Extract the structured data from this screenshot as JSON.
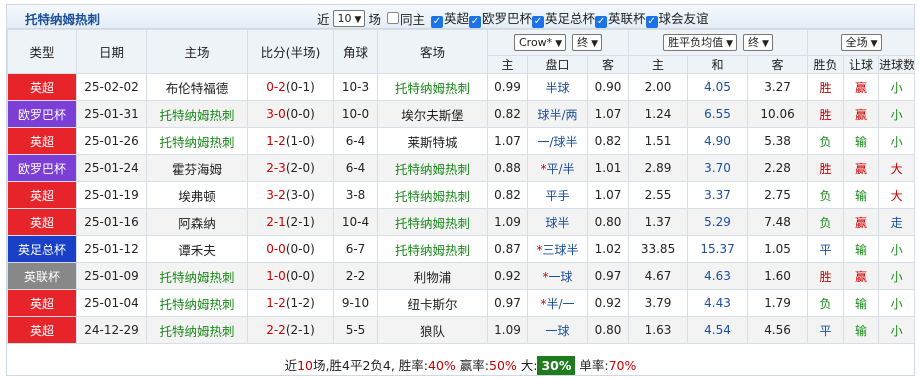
{
  "team_title": "托特纳姆热刺",
  "filter": {
    "prefix": "近",
    "count": "10",
    "suffix": "场",
    "same_home": "同主",
    "checks": [
      {
        "label": "英超",
        "on": true
      },
      {
        "label": "欧罗巴杯",
        "on": true
      },
      {
        "label": "英足总杯",
        "on": true
      },
      {
        "label": "英联杯",
        "on": true
      },
      {
        "label": "球会友谊",
        "on": true
      }
    ]
  },
  "headers": {
    "type": "类型",
    "date": "日期",
    "home": "主场",
    "score": "比分(半场)",
    "corner": "角球",
    "away": "客场",
    "company": "Crow*",
    "period1": "终",
    "period2": "终",
    "odds_type": "胜平负均值",
    "result_filter": "全场",
    "wl": "胜负",
    "hc": "让球",
    "ou": "进球数"
  },
  "sub": {
    "h": "主",
    "line": "盘口",
    "a": "客",
    "w": "主",
    "d": "和",
    "l": "客"
  },
  "rows": [
    {
      "league": "英超",
      "lc": "#e8242b",
      "date": "25-02-02",
      "home": "布伦特福德",
      "score": "0-2",
      "half": "(0-1)",
      "corner": "10-3",
      "away": "托特纳姆热刺",
      "ho": "0.99",
      "line": "半球",
      "ast": "",
      "ao": "0.90",
      "w": "2.00",
      "d": "4.05",
      "l": "3.27",
      "wl": "胜",
      "hc": "赢",
      "ou": "小"
    },
    {
      "league": "欧罗巴杯",
      "lc": "#7b3fd6",
      "date": "25-01-31",
      "home": "托特纳姆热刺",
      "score": "3-0",
      "half": "(0-0)",
      "corner": "10-0",
      "away": "埃尔夫斯堡",
      "ho": "0.82",
      "line": "球半/两",
      "ast": "",
      "ao": "1.07",
      "w": "1.24",
      "d": "6.55",
      "l": "10.06",
      "wl": "胜",
      "hc": "赢",
      "ou": "小"
    },
    {
      "league": "英超",
      "lc": "#e8242b",
      "date": "25-01-26",
      "home": "托特纳姆热刺",
      "score": "1-2",
      "half": "(1-0)",
      "corner": "6-4",
      "away": "莱斯特城",
      "ho": "1.07",
      "line": "一/球半",
      "ast": "",
      "ao": "0.82",
      "w": "1.51",
      "d": "4.90",
      "l": "5.38",
      "wl": "负",
      "hc": "输",
      "ou": "小"
    },
    {
      "league": "欧罗巴杯",
      "lc": "#7b3fd6",
      "date": "25-01-24",
      "home": "霍芬海姆",
      "score": "2-3",
      "half": "(2-0)",
      "corner": "6-4",
      "away": "托特纳姆热刺",
      "ho": "0.88",
      "line": "平/半",
      "ast": "*",
      "ao": "1.01",
      "w": "2.89",
      "d": "3.70",
      "l": "2.28",
      "wl": "胜",
      "hc": "赢",
      "ou": "大"
    },
    {
      "league": "英超",
      "lc": "#e8242b",
      "date": "25-01-19",
      "home": "埃弗顿",
      "score": "3-2",
      "half": "(3-0)",
      "corner": "3-8",
      "away": "托特纳姆热刺",
      "ho": "0.82",
      "line": "平手",
      "ast": "",
      "ao": "1.07",
      "w": "2.55",
      "d": "3.37",
      "l": "2.75",
      "wl": "负",
      "hc": "输",
      "ou": "大"
    },
    {
      "league": "英超",
      "lc": "#e8242b",
      "date": "25-01-16",
      "home": "阿森纳",
      "score": "2-1",
      "half": "(2-1)",
      "corner": "10-4",
      "away": "托特纳姆热刺",
      "ho": "1.09",
      "line": "球半",
      "ast": "",
      "ao": "0.80",
      "w": "1.37",
      "d": "5.29",
      "l": "7.48",
      "wl": "负",
      "hc": "赢",
      "ou": "走"
    },
    {
      "league": "英足总杯",
      "lc": "#1a40c8",
      "date": "25-01-12",
      "home": "谭禾夫",
      "score": "0-0",
      "half": "(0-0)",
      "corner": "6-7",
      "away": "托特纳姆热刺",
      "ho": "0.87",
      "line": "三球半",
      "ast": "*",
      "ao": "1.02",
      "w": "33.85",
      "d": "15.37",
      "l": "1.05",
      "wl": "平",
      "hc": "输",
      "ou": "小"
    },
    {
      "league": "英联杯",
      "lc": "#888888",
      "date": "25-01-09",
      "home": "托特纳姆热刺",
      "score": "1-0",
      "half": "(0-0)",
      "corner": "2-2",
      "away": "利物浦",
      "ho": "0.92",
      "line": "一球",
      "ast": "*",
      "ao": "0.97",
      "w": "4.67",
      "d": "4.63",
      "l": "1.60",
      "wl": "胜",
      "hc": "赢",
      "ou": "小"
    },
    {
      "league": "英超",
      "lc": "#e8242b",
      "date": "25-01-04",
      "home": "托特纳姆热刺",
      "score": "1-2",
      "half": "(1-2)",
      "corner": "9-10",
      "away": "纽卡斯尔",
      "ho": "0.97",
      "line": "半/一",
      "ast": "*",
      "ao": "0.92",
      "w": "3.79",
      "d": "4.43",
      "l": "1.79",
      "wl": "负",
      "hc": "输",
      "ou": "小"
    },
    {
      "league": "英超",
      "lc": "#e8242b",
      "date": "24-12-29",
      "home": "托特纳姆热刺",
      "score": "2-2",
      "half": "(2-1)",
      "corner": "5-5",
      "away": "狼队",
      "ho": "1.09",
      "line": "一球",
      "ast": "",
      "ao": "0.80",
      "w": "1.63",
      "d": "4.54",
      "l": "4.56",
      "wl": "平",
      "hc": "输",
      "ou": "小"
    }
  ],
  "footer": {
    "a": "近",
    "n": "10",
    "b": "场,胜4平2负4, 胜率:",
    "win": "40%",
    "c": " 赢率:",
    "cover": "50%",
    "d": " 大:",
    "big": "30%",
    "e": " 单率:",
    "odd": "70%"
  }
}
